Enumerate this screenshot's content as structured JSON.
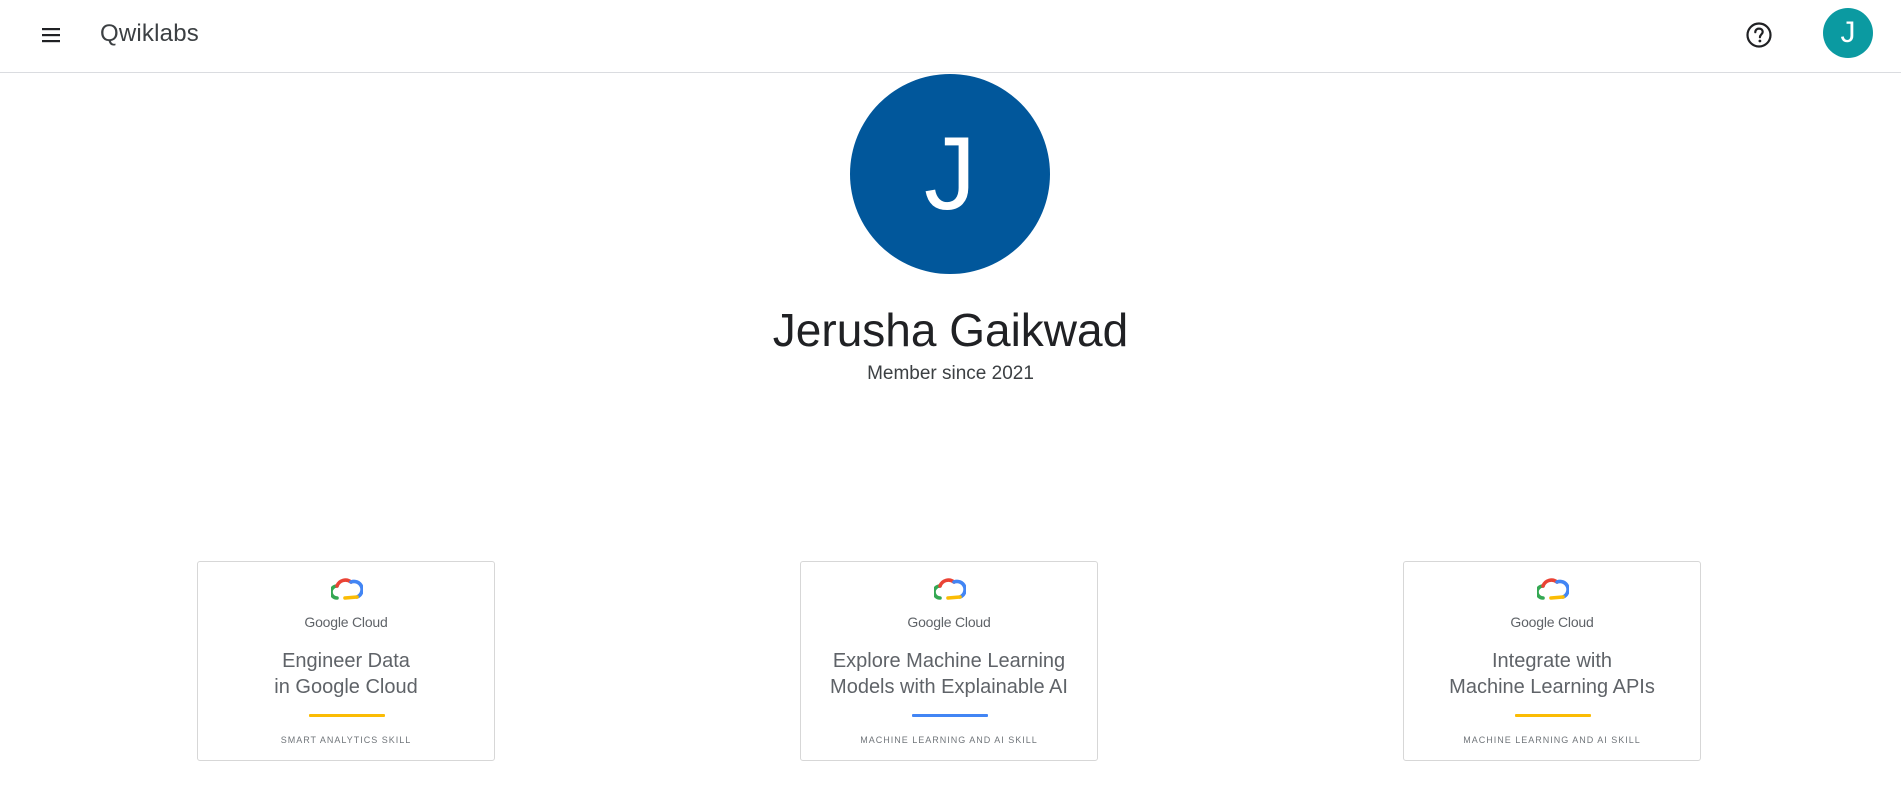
{
  "header": {
    "brand": "Qwiklabs",
    "menu_icon": "menu-icon",
    "help_icon": "help-icon",
    "avatar_initial": "J"
  },
  "profile": {
    "avatar_initial": "J",
    "name": "Jerusha Gaikwad",
    "member_since": "Member since 2021",
    "avatar_color": "#01579b"
  },
  "badges": [
    {
      "brand": "Google Cloud",
      "title": "Engineer Data\nin Google Cloud",
      "skill": "SMART ANALYTICS SKILL",
      "accent": "#fbbc04"
    },
    {
      "brand": "Google Cloud",
      "title": "Explore Machine Learning\nModels with Explainable AI",
      "skill": "MACHINE LEARNING AND AI SKILL",
      "accent": "#4285f4"
    },
    {
      "brand": "Google Cloud",
      "title": "Integrate with\nMachine Learning APIs",
      "skill": "MACHINE LEARNING AND AI SKILL",
      "accent": "#fbbc04"
    }
  ]
}
